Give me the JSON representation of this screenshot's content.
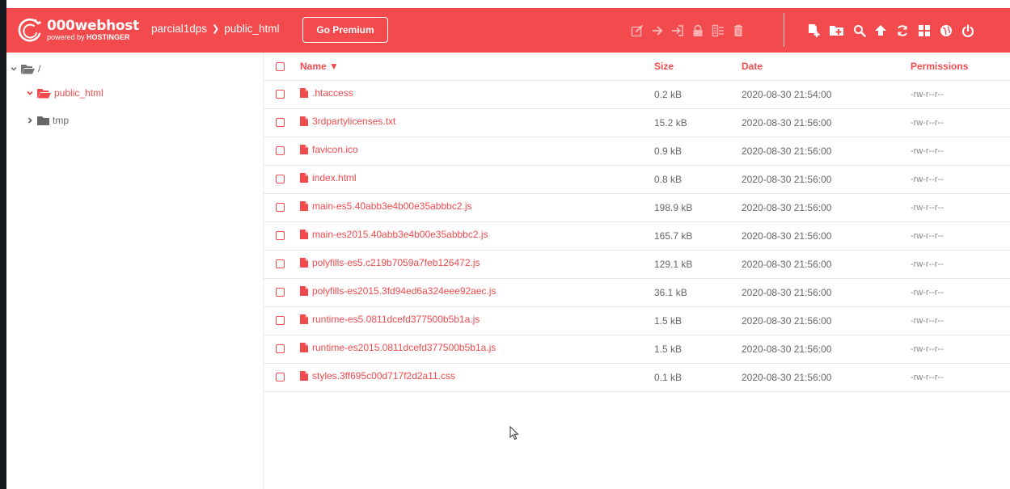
{
  "colors": {
    "accent": "#f24a4d",
    "text_muted": "#666666",
    "border": "#e8e8e8"
  },
  "header": {
    "logo_name": "000webhost",
    "logo_sub_prefix": "powered by",
    "logo_sub_brand": "HOSTINGER",
    "breadcrumb": [
      "parcial1dps",
      "public_html"
    ],
    "premium_label": "Go Premium",
    "tools_dim": [
      "edit-icon",
      "move-icon",
      "rename-icon",
      "lock-icon",
      "extract-icon",
      "delete-icon"
    ],
    "tools_active": [
      "new-file-icon",
      "new-folder-icon",
      "search-icon",
      "upload-icon",
      "refresh-icon",
      "grid-view-icon",
      "globe-icon",
      "power-icon"
    ]
  },
  "sidebar": {
    "root_label": "/",
    "items": [
      {
        "label": "public_html",
        "icon": "folder-open-icon",
        "expanded": true,
        "active": true
      },
      {
        "label": "tmp",
        "icon": "folder-icon",
        "expanded": false,
        "active": false
      }
    ]
  },
  "table": {
    "columns": [
      "Name ▼",
      "Size",
      "Date",
      "Permissions"
    ],
    "rows": [
      {
        "name": ".htaccess",
        "size": "0.2 kB",
        "date": "2020-08-30 21:54:00",
        "perm": "-rw-r--r--"
      },
      {
        "name": "3rdpartylicenses.txt",
        "size": "15.2 kB",
        "date": "2020-08-30 21:56:00",
        "perm": "-rw-r--r--"
      },
      {
        "name": "favicon.ico",
        "size": "0.9 kB",
        "date": "2020-08-30 21:56:00",
        "perm": "-rw-r--r--"
      },
      {
        "name": "index.html",
        "size": "0.8 kB",
        "date": "2020-08-30 21:56:00",
        "perm": "-rw-r--r--"
      },
      {
        "name": "main-es5.40abb3e4b00e35abbbc2.js",
        "size": "198.9 kB",
        "date": "2020-08-30 21:56:00",
        "perm": "-rw-r--r--"
      },
      {
        "name": "main-es2015.40abb3e4b00e35abbbc2.js",
        "size": "165.7 kB",
        "date": "2020-08-30 21:56:00",
        "perm": "-rw-r--r--"
      },
      {
        "name": "polyfills-es5.c219b7059a7feb126472.js",
        "size": "129.1 kB",
        "date": "2020-08-30 21:56:00",
        "perm": "-rw-r--r--"
      },
      {
        "name": "polyfills-es2015.3fd94ed6a324eee92aec.js",
        "size": "36.1 kB",
        "date": "2020-08-30 21:56:00",
        "perm": "-rw-r--r--"
      },
      {
        "name": "runtime-es5.0811dcefd377500b5b1a.js",
        "size": "1.5 kB",
        "date": "2020-08-30 21:56:00",
        "perm": "-rw-r--r--"
      },
      {
        "name": "runtime-es2015.0811dcefd377500b5b1a.js",
        "size": "1.5 kB",
        "date": "2020-08-30 21:56:00",
        "perm": "-rw-r--r--"
      },
      {
        "name": "styles.3ff695c00d717f2d2a11.css",
        "size": "0.1 kB",
        "date": "2020-08-30 21:56:00",
        "perm": "-rw-r--r--"
      }
    ]
  }
}
